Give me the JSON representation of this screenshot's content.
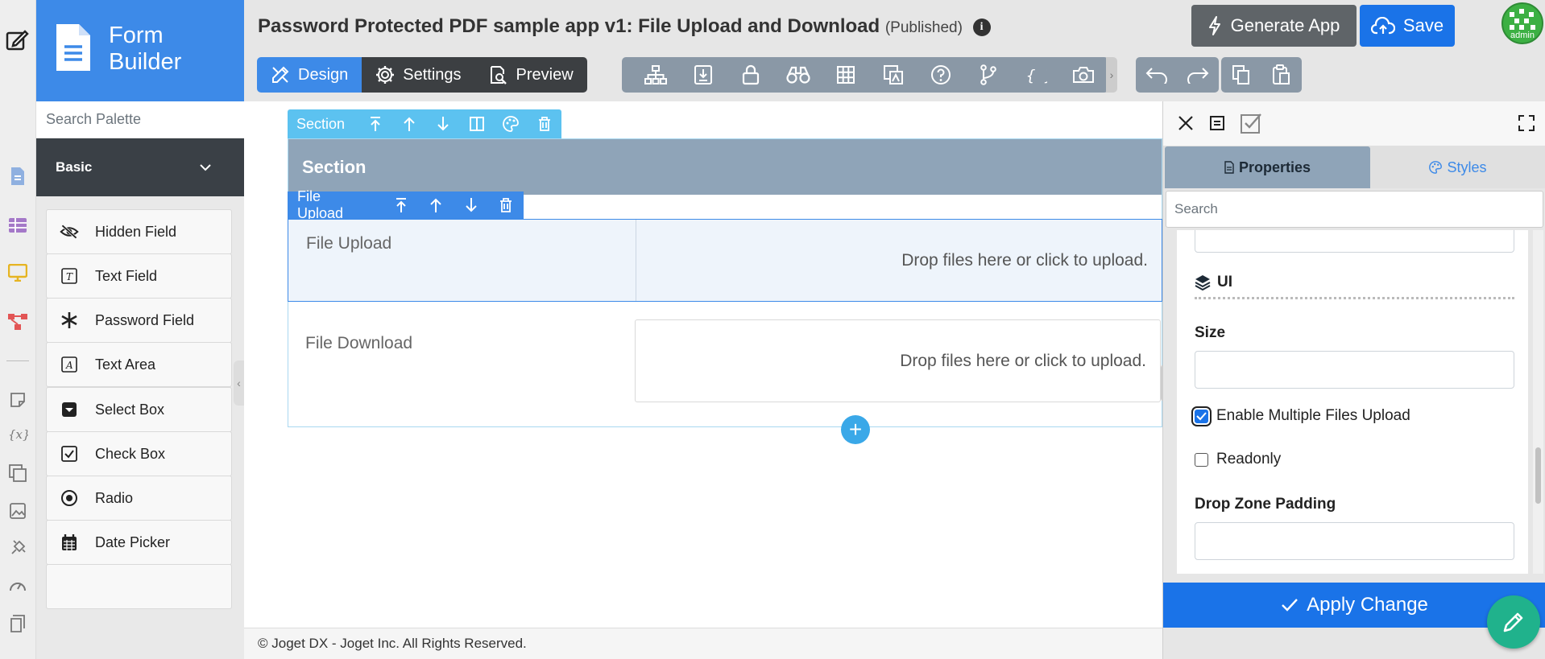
{
  "app": {
    "title": "Password Protected PDF sample app v1: File Upload and Download",
    "status": "(Published)",
    "info_icon": "i"
  },
  "brand": {
    "line1": "Form",
    "line2": "Builder"
  },
  "palette": {
    "search_placeholder": "Search Palette",
    "category": "Basic",
    "items": [
      {
        "label": "Hidden Field",
        "icon": "eye-slash-icon"
      },
      {
        "label": "Text Field",
        "icon": "text-field-icon"
      },
      {
        "label": "Password Field",
        "icon": "asterisk-icon"
      },
      {
        "label": "Text Area",
        "icon": "text-area-icon"
      },
      {
        "label": "Select Box",
        "icon": "select-box-icon"
      },
      {
        "label": "Check Box",
        "icon": "check-box-icon"
      },
      {
        "label": "Radio",
        "icon": "radio-icon"
      },
      {
        "label": "Date Picker",
        "icon": "calendar-icon"
      }
    ]
  },
  "modes": {
    "design": "Design",
    "settings": "Settings",
    "preview": "Preview"
  },
  "actions": {
    "generate": "Generate App",
    "save": "Save",
    "avatar_label": "admin"
  },
  "canvas": {
    "section_toolbar_label": "Section",
    "section_title": "Section",
    "field_toolbar_label": "File Upload",
    "fields": [
      {
        "label": "File Upload",
        "dropzone": "Drop files here or click to upload."
      },
      {
        "label": "File Download",
        "dropzone": "Drop files here or click to upload."
      }
    ],
    "add_symbol": "+"
  },
  "footer": "© Joget DX - Joget Inc. All Rights Reserved.",
  "properties_panel": {
    "tab_properties": "Properties",
    "tab_styles": "Styles",
    "search_placeholder": "Search",
    "ui_heading": "UI",
    "size_label": "Size",
    "size_value": "",
    "enable_multiple_label": "Enable Multiple Files Upload",
    "enable_multiple_checked": true,
    "readonly_label": "Readonly",
    "readonly_checked": false,
    "drop_zone_padding_label": "Drop Zone Padding",
    "drop_zone_padding_value": "",
    "apply_label": "Apply Change"
  },
  "colors": {
    "brand_blue": "#3d8ae8",
    "save_blue": "#1a73e8",
    "section_header": "#8fa4b8",
    "section_toolbar": "#5cc2f0",
    "toolbar_gray": "#8a98a6",
    "pencil_green": "#20b28c"
  }
}
